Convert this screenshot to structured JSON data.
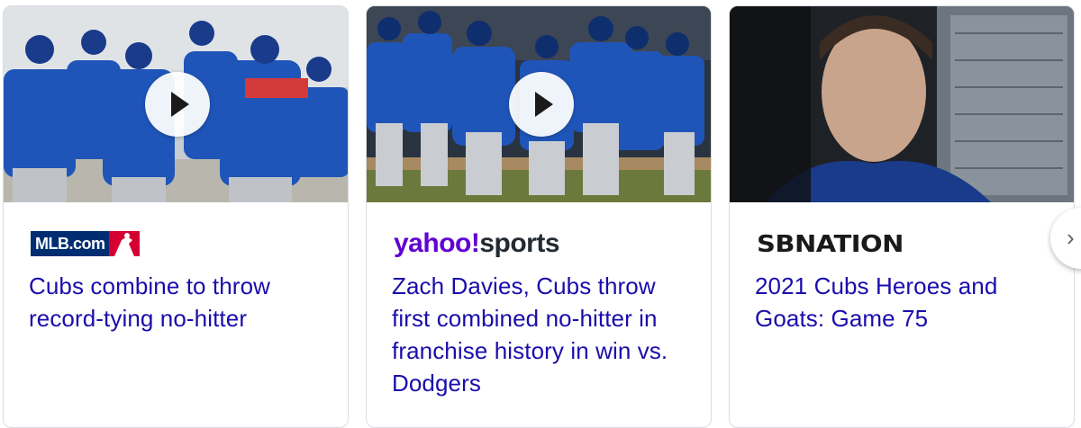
{
  "cards": [
    {
      "source": "MLB.com",
      "title": "Cubs combine to throw record-tying no-hitter",
      "has_video": true
    },
    {
      "source_part1": "yahoo!",
      "source_part2": "sports",
      "title": "Zach Davies, Cubs throw first combined no-hitter in franchise history in win vs. Dodgers",
      "has_video": true
    },
    {
      "source": "SBNATION",
      "title": "2021 Cubs Heroes and Goats: Game 75",
      "has_video": false
    }
  ],
  "colors": {
    "link": "#1a0dab",
    "yahoo_purple": "#6001d2",
    "mlb_navy": "#002d72",
    "mlb_red": "#d50032",
    "cubs_blue": "#1a4ea8"
  },
  "icons": {
    "play": "play-icon",
    "next": "chevron-right-icon"
  }
}
